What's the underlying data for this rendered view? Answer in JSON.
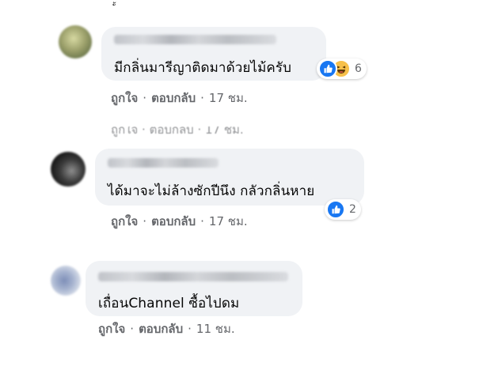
{
  "comments": [
    {
      "text": "มีกลิ่นมารีญาติดมาด้วยไม้ครับ",
      "like_label": "ถูกใจ",
      "reply_label": "ตอบกลับ",
      "time": "17 ชม.",
      "reaction_count": "6",
      "reaction_icons": [
        "like-icon",
        "haha-icon"
      ]
    },
    {
      "text": "ได้มาจะไม่ล้างซักปีนึง กลัวกลิ่นหาย",
      "like_label": "ถูกใจ",
      "reply_label": "ตอบกลับ",
      "time": "17 ชม.",
      "reaction_count": "2",
      "reaction_icons": [
        "like-icon"
      ]
    },
    {
      "text": "เถื่อนChannel ซื้อไปดม",
      "like_label": "ถูกใจ",
      "reply_label": "ตอบกลับ",
      "time": "11 ชม.",
      "reaction_icons": []
    }
  ],
  "separator": "·",
  "colors": {
    "bubble": "#f0f2f5",
    "meta_text": "#65676b",
    "like_blue": "#1877f2",
    "haha_yellow": "#f7c04a"
  }
}
